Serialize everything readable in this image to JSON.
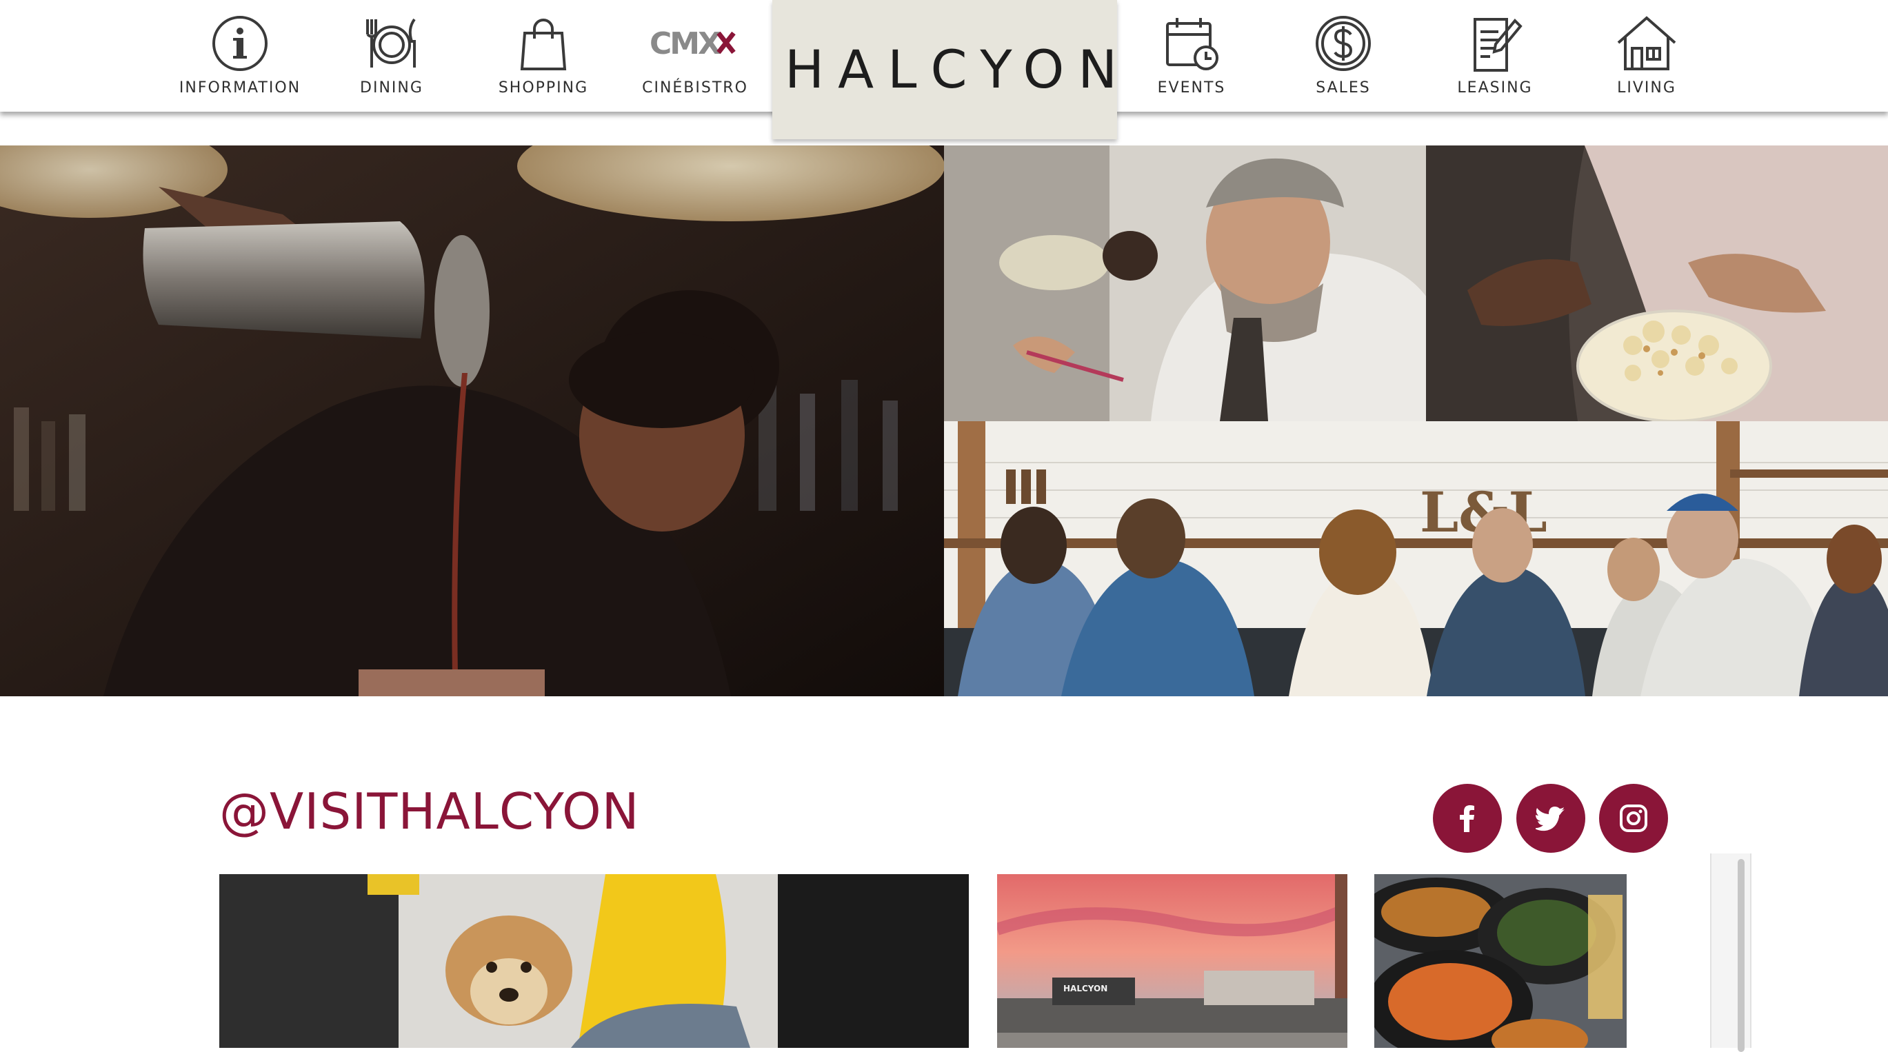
{
  "brand": {
    "logo_text": "HALCYON",
    "background": "#e7e5dc"
  },
  "nav": {
    "items": [
      {
        "label": "INFORMATION",
        "icon": "info-icon"
      },
      {
        "label": "DINING",
        "icon": "dining-icon"
      },
      {
        "label": "SHOPPING",
        "icon": "shopping-bag-icon"
      },
      {
        "label": "CINÉBISTRO",
        "icon": "cmx-logo-icon",
        "logo_text": "CMX"
      },
      {
        "label": "EVENTS",
        "icon": "calendar-clock-icon"
      },
      {
        "label": "SALES",
        "icon": "dollar-circle-icon"
      },
      {
        "label": "LEASING",
        "icon": "document-pen-icon"
      },
      {
        "label": "LIVING",
        "icon": "house-icon"
      }
    ]
  },
  "hero": {
    "photos": [
      {
        "name": "bartender-pouring-cocktail"
      },
      {
        "name": "chef-plating-dish"
      },
      {
        "name": "popcorn-bowl"
      },
      {
        "name": "friends-at-bar",
        "sign_text": "L&L"
      }
    ]
  },
  "social": {
    "handle": "@VISITHALCYON",
    "accent": "#8a1538",
    "links": [
      {
        "name": "facebook",
        "icon": "facebook-icon"
      },
      {
        "name": "twitter",
        "icon": "twitter-icon"
      },
      {
        "name": "instagram",
        "icon": "instagram-icon"
      }
    ],
    "feed": [
      {
        "name": "dog-at-patio"
      },
      {
        "name": "halcyon-sunset"
      },
      {
        "name": "food-platters"
      }
    ],
    "feed_sign_text": "HALCYON"
  }
}
